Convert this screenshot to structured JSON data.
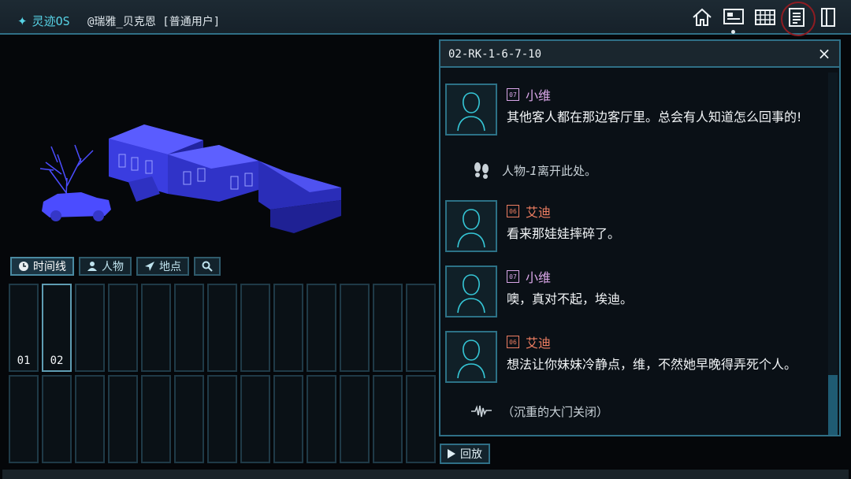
{
  "topbar": {
    "brand": "灵迹OS",
    "user": "@瑞雅_贝克恩 [普通用户]",
    "icons": [
      "home-icon",
      "monitor-icon",
      "grid-icon",
      "notes-icon",
      "panel-icon"
    ]
  },
  "left": {
    "tabs": [
      {
        "label": "时间线",
        "icon": "clock-icon"
      },
      {
        "label": "人物",
        "icon": "person-icon"
      },
      {
        "label": "地点",
        "icon": "location-icon"
      },
      {
        "label": "",
        "icon": "search-icon"
      }
    ],
    "timeline_labels": [
      "01",
      "02"
    ]
  },
  "dialog": {
    "title": "02-RK-1-6-7-10",
    "close": "×",
    "messages": [
      {
        "id": "07",
        "name": "小维",
        "color": "#d9a6e8",
        "text": "其他客人都在那边客厅里。总会有人知道怎么回事的!"
      },
      {
        "id": "06",
        "name": "艾迪",
        "color": "#ef7e62",
        "text": "看来那娃娃摔碎了。"
      },
      {
        "id": "07",
        "name": "小维",
        "color": "#d9a6e8",
        "text": "噢，真对不起，埃迪。"
      },
      {
        "id": "06",
        "name": "艾迪",
        "color": "#ef7e62",
        "text": "想法让你妹妹冷静点，维，不然她早晚得弄死个人。"
      }
    ],
    "events": {
      "leave_person": "人物-",
      "leave_person_italic": "1",
      "leave_rest": "离开此处。",
      "sound": "（沉重的大门关闭）"
    }
  },
  "replay": {
    "label": "回放"
  },
  "colors": {
    "accent": "#57d3e6",
    "border": "#2f6f86",
    "model": "#4b4cff"
  }
}
